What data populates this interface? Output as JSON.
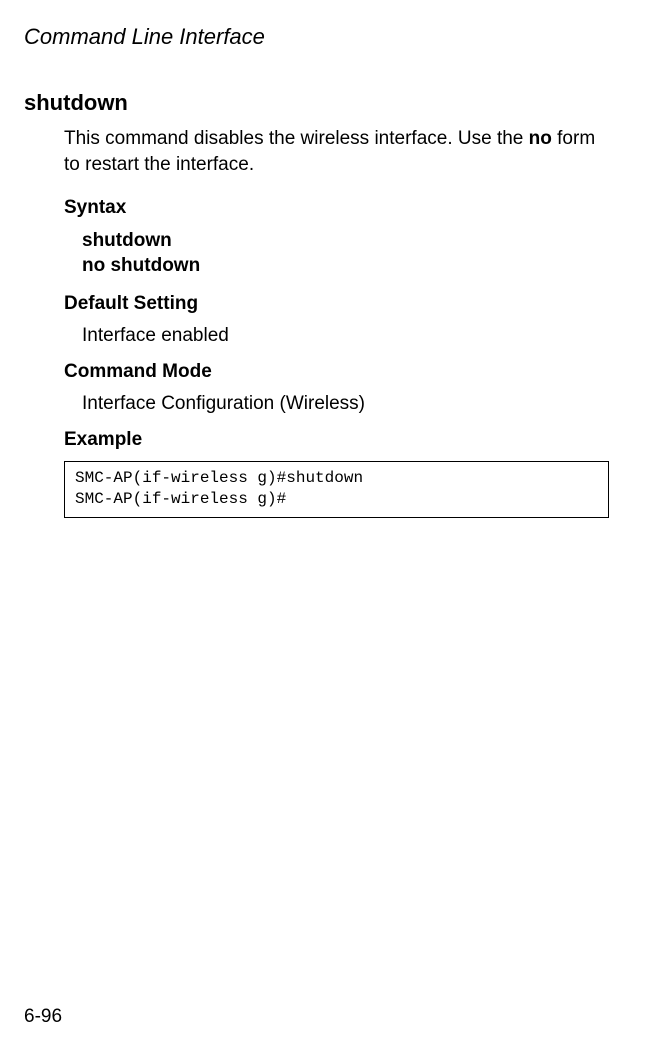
{
  "chapterTitle": "Command Line Interface",
  "commandTitle": "shutdown",
  "description": {
    "pre": "This command disables the wireless interface. Use the ",
    "boldWord": "no",
    "post": " form to restart the interface."
  },
  "sections": {
    "syntax": {
      "heading": "Syntax",
      "line1": "shutdown",
      "line2": "no shutdown"
    },
    "defaultSetting": {
      "heading": "Default Setting",
      "value": "Interface enabled"
    },
    "commandMode": {
      "heading": "Command Mode",
      "value": "Interface Configuration (Wireless)"
    },
    "example": {
      "heading": "Example",
      "code": "SMC-AP(if-wireless g)#shutdown\nSMC-AP(if-wireless g)#"
    }
  },
  "pageNumber": "6-96"
}
